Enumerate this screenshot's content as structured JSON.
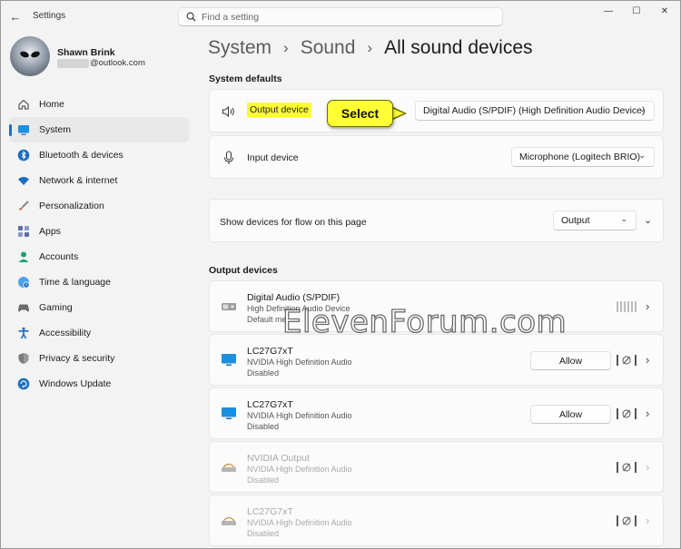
{
  "app": {
    "title": "Settings",
    "back_icon": "arrow-left-icon"
  },
  "search": {
    "placeholder": "Find a setting"
  },
  "window_controls": {
    "minimize": "—",
    "maximize": "☐",
    "close": "✕"
  },
  "user": {
    "name": "Shawn Brink",
    "email": "@outlook.com"
  },
  "nav": {
    "items": [
      {
        "label": "Home",
        "icon": "home-icon",
        "color": "#5b5b5b"
      },
      {
        "label": "System",
        "icon": "monitor-icon",
        "color": "#1b6ec2",
        "active": true
      },
      {
        "label": "Bluetooth & devices",
        "icon": "bluetooth-icon",
        "color": "#1b6ec2"
      },
      {
        "label": "Network & internet",
        "icon": "wifi-icon",
        "color": "#1b6ec2"
      },
      {
        "label": "Personalization",
        "icon": "brush-icon",
        "color": "#c65a2e"
      },
      {
        "label": "Apps",
        "icon": "apps-icon",
        "color": "#5b6bb0"
      },
      {
        "label": "Accounts",
        "icon": "accounts-icon",
        "color": "#1fa36b"
      },
      {
        "label": "Time & language",
        "icon": "globe-clock-icon",
        "color": "#1b6ec2"
      },
      {
        "label": "Gaming",
        "icon": "gamepad-icon",
        "color": "#6b6b6b"
      },
      {
        "label": "Accessibility",
        "icon": "accessibility-icon",
        "color": "#1b6ec2"
      },
      {
        "label": "Privacy & security",
        "icon": "shield-icon",
        "color": "#6b6b6b"
      },
      {
        "label": "Windows Update",
        "icon": "update-icon",
        "color": "#1b6ec2"
      }
    ]
  },
  "breadcrumb": {
    "first": "System",
    "second": "Sound",
    "current": "All sound devices",
    "separator": "›"
  },
  "system_defaults": {
    "heading": "System defaults",
    "output": {
      "label": "Output device",
      "value": "Digital Audio (S/PDIF) (High Definition Audio Device)"
    },
    "input": {
      "label": "Input device",
      "value": "Microphone (Logitech BRIO)"
    },
    "flow": {
      "label": "Show devices for flow on this page",
      "value": "Output"
    }
  },
  "callout": {
    "text": "Select",
    "color": "#ffff33"
  },
  "output_devices": {
    "heading": "Output devices",
    "allow_label": "Allow",
    "devices": [
      {
        "name": "Digital Audio (S/PDIF)",
        "sub": "High Definition Audio Device",
        "status": "Default me",
        "icon": "speaker-device-icon",
        "disabled": false,
        "allow": false
      },
      {
        "name": "LC27G7xT",
        "sub": "NVIDIA High Definition Audio",
        "status": "Disabled",
        "icon": "monitor-icon",
        "disabled": false,
        "allow": true
      },
      {
        "name": "LC27G7xT",
        "sub": "NVIDIA High Definition Audio",
        "status": "Disabled",
        "icon": "monitor-icon",
        "disabled": false,
        "allow": true
      },
      {
        "name": "NVIDIA Output",
        "sub": "NVIDIA High Definition Audio",
        "status": "Disabled",
        "icon": "speaker-device-icon",
        "disabled": true,
        "allow": false
      },
      {
        "name": "LC27G7xT",
        "sub": "NVIDIA High Definition Audio",
        "status": "Disabled",
        "icon": "speaker-device-icon",
        "disabled": true,
        "allow": false
      }
    ]
  },
  "watermark": "ElevenForum.com"
}
